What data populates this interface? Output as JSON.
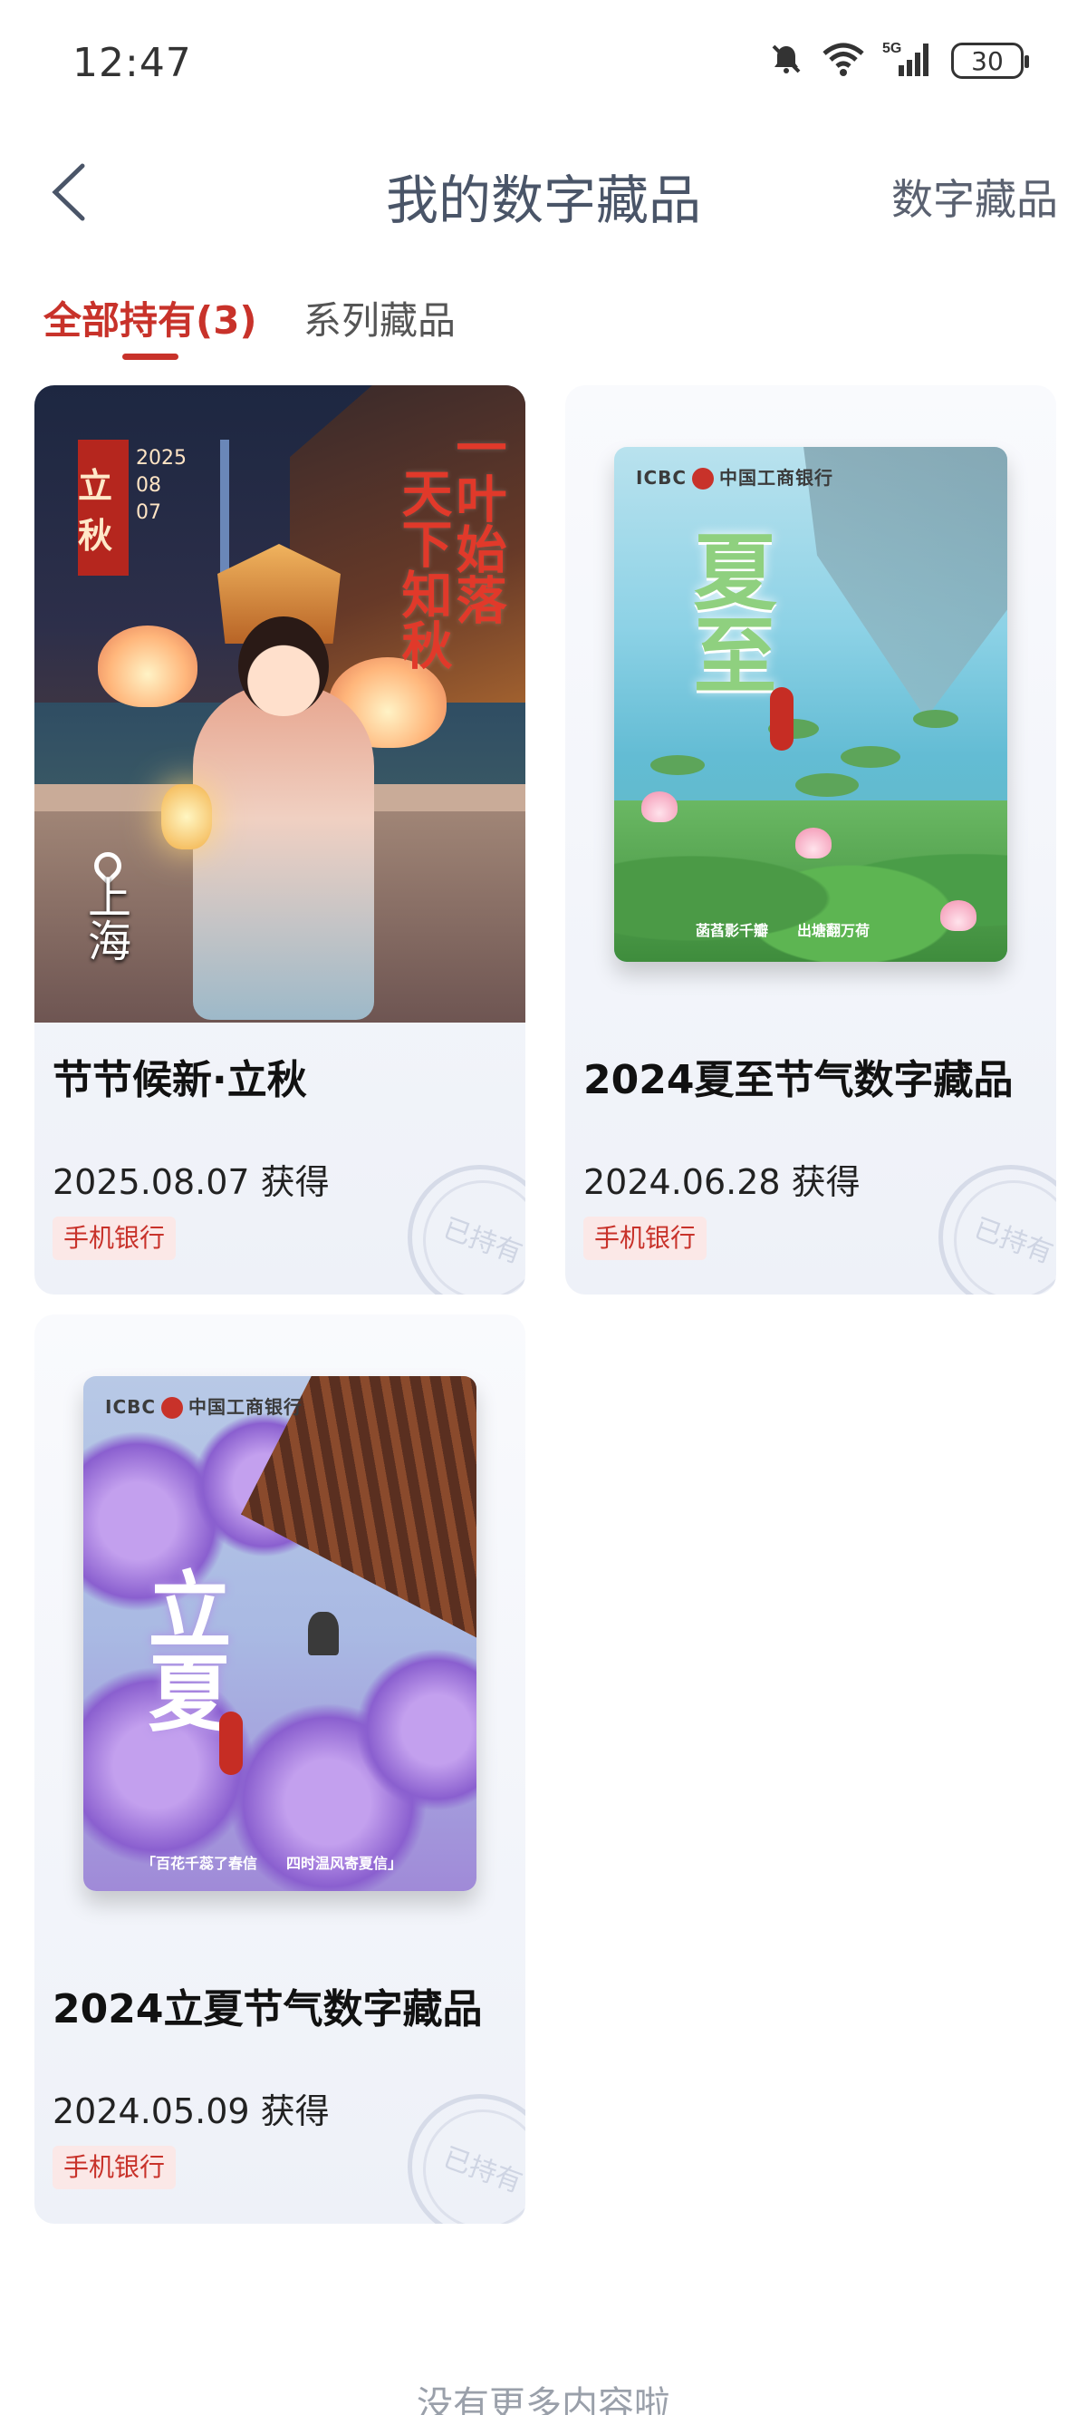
{
  "status_bar": {
    "time": "12:47",
    "signal_label": "5G",
    "battery": "30"
  },
  "header": {
    "title": "我的数字藏品",
    "right_link": "数字藏品"
  },
  "tabs": [
    {
      "label": "全部持有(3)",
      "active": true
    },
    {
      "label": "系列藏品",
      "active": false
    }
  ],
  "collectibles": [
    {
      "title": "节节候新·立秋",
      "date": "2025.08.07 获得",
      "source": "手机银行",
      "stamp": "已持有",
      "art": {
        "seal": "立秋",
        "seal_year": "2025",
        "seal_month": "08",
        "seal_day": "07",
        "poem_right": "一叶始落",
        "poem_left": "天下知秋",
        "city": "上海"
      }
    },
    {
      "title": "2024夏至节气数字藏品",
      "date": "2024.06.28 获得",
      "source": "手机银行",
      "stamp": "已持有",
      "art": {
        "brand_icbc": "ICBC",
        "brand_cn": "中国工商银行",
        "name": "夏至",
        "caption": "菡萏影千瓣　　出塘翻万荷"
      }
    },
    {
      "title": "2024立夏节气数字藏品",
      "date": "2024.05.09 获得",
      "source": "手机银行",
      "stamp": "已持有",
      "art": {
        "brand_icbc": "ICBC",
        "brand_cn": "中国工商银行",
        "name": "立夏",
        "caption": "「百花千蕊了春信　　四时温风寄夏信」"
      }
    }
  ],
  "footer": {
    "end_text": "没有更多内容啦"
  },
  "colors": {
    "accent": "#c8322a",
    "title_gray": "#4a5568"
  }
}
